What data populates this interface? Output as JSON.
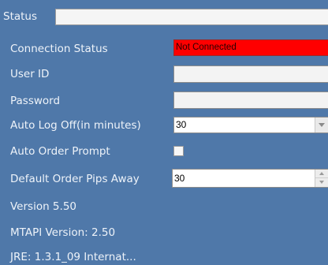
{
  "status": {
    "label": "Status",
    "value": ""
  },
  "connection": {
    "label": "Connection Status",
    "value": "Not Connected",
    "color": "#ff0000"
  },
  "user_id": {
    "label": "User ID",
    "value": ""
  },
  "password": {
    "label": "Password",
    "value": ""
  },
  "auto_logoff": {
    "label": "Auto Log Off(in minutes)",
    "value": "30"
  },
  "auto_order_prompt": {
    "label": "Auto Order Prompt",
    "checked": false
  },
  "pips_away": {
    "label": "Default Order Pips Away",
    "value": "30"
  },
  "info": {
    "version": "Version 5.50",
    "mtapi_version": "MTAPI Version: 2.50",
    "jre": "JRE: 1.3.1_09 Internat..."
  },
  "colors": {
    "panel_bg": "#4f78a9",
    "label_text": "#eef3f9"
  }
}
